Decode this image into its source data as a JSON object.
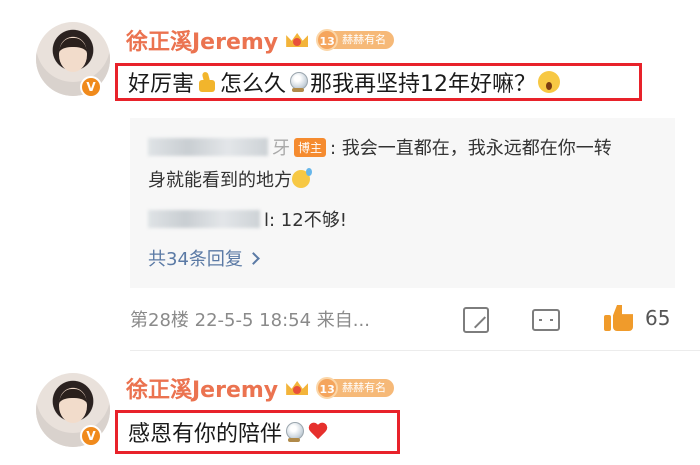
{
  "colors": {
    "username": "#eb7350",
    "highlight_border": "#e8222a",
    "link": "#5b7aa5",
    "like": "#f09b2b",
    "fan_badge": "#f6b978",
    "verified": "#f08a1c"
  },
  "comment1": {
    "username": "徐正溪Jeremy",
    "fan_level": "13",
    "fan_label": "赫赫有名",
    "content_part1": "好厉害",
    "content_part2": "怎么久",
    "content_part3": "那我再坚持12年好嘛？",
    "icons": [
      "thumbs-up-icon",
      "crystal-ball-icon",
      "scream-icon"
    ],
    "replies": [
      {
        "blogger_tag": "博主",
        "text_line1": ": 我会一直都在，我永远都在你一转",
        "text_line2": "身就能看到的地方"
      },
      {
        "text": "l: 12不够!"
      }
    ],
    "reply_count_label": "共34条回复",
    "floor": "第28楼",
    "date": "22-5-5 18:54",
    "source": "来自...",
    "likes": "65"
  },
  "comment2": {
    "username": "徐正溪Jeremy",
    "fan_level": "13",
    "fan_label": "赫赫有名",
    "content": "感恩有你的陪伴",
    "icons": [
      "crystal-ball-icon",
      "heart-icon"
    ]
  }
}
